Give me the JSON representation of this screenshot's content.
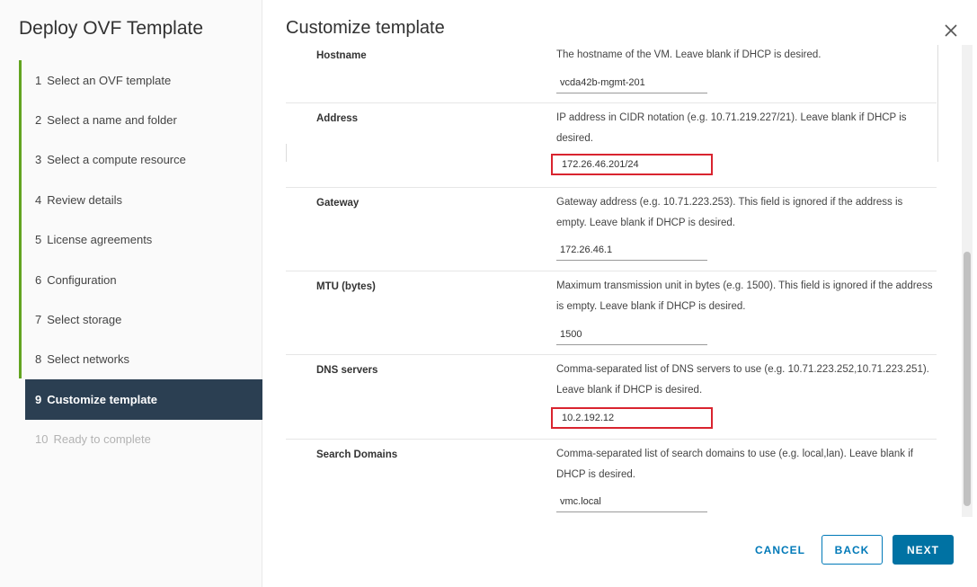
{
  "wizard": {
    "title": "Deploy OVF Template",
    "steps": [
      {
        "num": "1",
        "label": "Select an OVF template"
      },
      {
        "num": "2",
        "label": "Select a name and folder"
      },
      {
        "num": "3",
        "label": "Select a compute resource"
      },
      {
        "num": "4",
        "label": "Review details"
      },
      {
        "num": "5",
        "label": "License agreements"
      },
      {
        "num": "6",
        "label": "Configuration"
      },
      {
        "num": "7",
        "label": "Select storage"
      },
      {
        "num": "8",
        "label": "Select networks"
      },
      {
        "num": "9",
        "label": "Customize template"
      },
      {
        "num": "10",
        "label": "Ready to complete"
      }
    ]
  },
  "content": {
    "title": "Customize template",
    "fields": [
      {
        "label": "Hostname",
        "description": "The hostname of the VM. Leave blank if DHCP is desired.",
        "value": "vcda42b-mgmt-201"
      },
      {
        "label": "Address",
        "description": "IP address in CIDR notation (e.g. 10.71.219.227/21). Leave blank if DHCP is desired.",
        "value": "172.26.46.201/24"
      },
      {
        "label": "Gateway",
        "description": "Gateway address (e.g. 10.71.223.253). This field is ignored if the address is empty. Leave blank if DHCP is desired.",
        "value": "172.26.46.1"
      },
      {
        "label": "MTU (bytes)",
        "description": "Maximum transmission unit in bytes (e.g. 1500). This field is ignored if the address is empty. Leave blank if DHCP is desired.",
        "value": "1500"
      },
      {
        "label": "DNS servers",
        "description": "Comma-separated list of DNS servers to use (e.g. 10.71.223.252,10.71.223.251). Leave blank if DHCP is desired.",
        "value": "10.2.192.12"
      },
      {
        "label": "Search Domains",
        "description": "Comma-separated list of search domains to use (e.g. local,lan). Leave blank if DHCP is desired.",
        "value": "vmc.local"
      }
    ]
  },
  "footer": {
    "cancel_label": "CANCEL",
    "back_label": "BACK",
    "next_label": "NEXT"
  },
  "colors": {
    "accent": "#0079b8",
    "active_step_bg": "#2b3f52",
    "progress_green": "#62a420",
    "highlight_red": "#d9242f"
  },
  "icons": {
    "close": "close-icon"
  }
}
